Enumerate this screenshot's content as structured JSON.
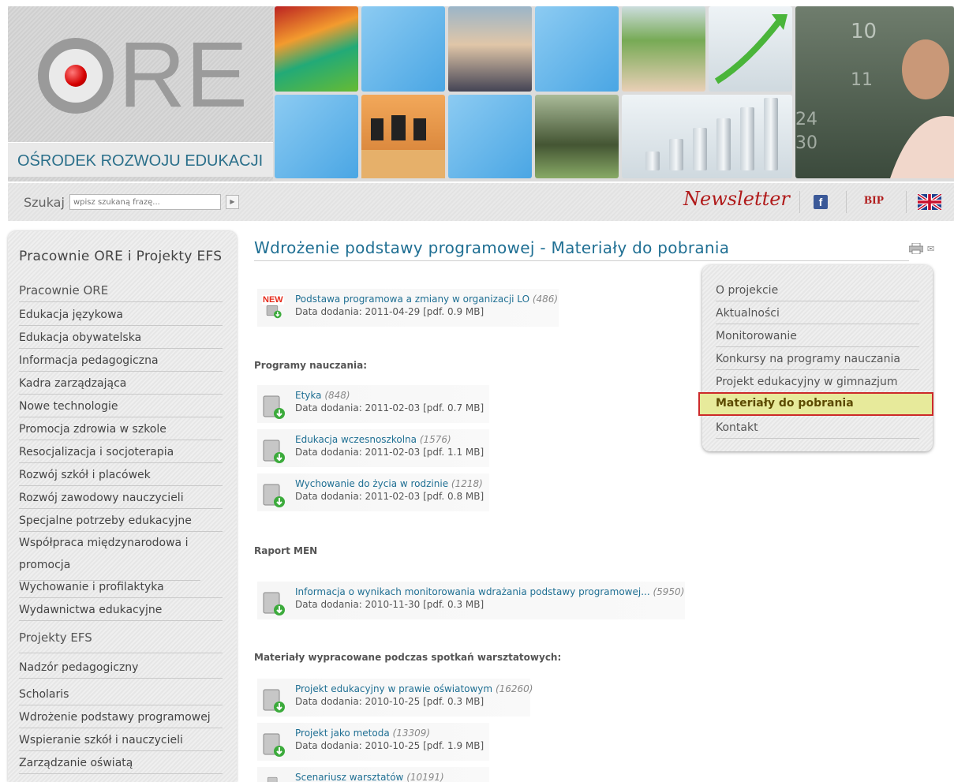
{
  "header": {
    "logo_text": "ORE",
    "logo_re": "RE",
    "org_name": "OŚRODEK ROZWOJU EDUKACJI"
  },
  "search": {
    "label": "Szukaj",
    "placeholder": "wpisz szukaną frazę...",
    "button_glyph": "▶"
  },
  "topbar": {
    "newsletter": "Newsletter",
    "facebook_glyph": "f",
    "bip": "BIP",
    "english_flag": "uk-flag-icon"
  },
  "sidebar": {
    "title": "Pracownie ORE i Projekty EFS",
    "section1": "Pracownie ORE",
    "items1": [
      "Edukacja językowa",
      "Edukacja obywatelska",
      "Informacja pedagogiczna",
      "Kadra zarządzająca",
      "Nowe technologie",
      "Promocja zdrowia w szkole",
      "Resocjalizacja i socjoterapia",
      "Rozwój szkół i placówek",
      "Rozwój zawodowy nauczycieli",
      "Specjalne potrzeby edukacyjne",
      "Współpraca międzynarodowa i promocja",
      "Wychowanie i profilaktyka",
      "Wydawnictwa edukacyjne"
    ],
    "section2": "Projekty EFS",
    "items2": [
      "Nadzór pedagogiczny",
      "Scholaris",
      "Wdrożenie podstawy programowej",
      "Wspieranie szkół i nauczycieli",
      "Zarządzanie oświatą"
    ]
  },
  "main": {
    "title": "Wdrożenie podstawy programowej - Materiały do pobrania",
    "new_badge": "NEW",
    "docs_top": [
      {
        "title": "Podstawa programowa a zmiany w organizacji LO",
        "count": "(486)",
        "meta": "Data dodania: 2011-04-29 [pdf. 0.9 MB]"
      }
    ],
    "section_programs": "Programy nauczania:",
    "docs_programs": [
      {
        "title": "Etyka",
        "count": "(848)",
        "meta": "Data dodania: 2011-02-03 [pdf. 0.7 MB]"
      },
      {
        "title": "Edukacja wczesnoszkolna",
        "count": "(1576)",
        "meta": "Data dodania: 2011-02-03 [pdf. 1.1 MB]"
      },
      {
        "title": "Wychowanie do życia w rodzinie",
        "count": "(1218)",
        "meta": "Data dodania: 2011-02-03 [pdf. 0.8 MB]"
      }
    ],
    "section_raport": "Raport MEN",
    "docs_raport": [
      {
        "title": "Informacja o wynikach monitorowania wdrażania podstawy programowej...",
        "count": "(5950)",
        "meta": "Data dodania: 2010-11-30 [pdf. 0.3 MB]"
      }
    ],
    "section_workshops": "Materiały wypracowane podczas spotkań warsztatowych:",
    "docs_workshops": [
      {
        "title": "Projekt edukacyjny w prawie oświatowym",
        "count": "(16260)",
        "meta": "Data dodania: 2010-10-25 [pdf. 0.3 MB]"
      },
      {
        "title": "Projekt jako metoda",
        "count": "(13309)",
        "meta": "Data dodania: 2010-10-25 [pdf. 1.9 MB]"
      },
      {
        "title": "Scenariusz warsztatów",
        "count": "(10191)",
        "meta": ""
      }
    ]
  },
  "submenu": {
    "items": [
      "O projekcie",
      "Aktualności",
      "Monitorowanie",
      "Konkursy na programy nauczania",
      "Projekt edukacyjny w gimnazjum",
      "Materiały do pobrania",
      "Kontakt"
    ],
    "active_index": 5
  },
  "colors": {
    "link": "#1f6f93",
    "active_bg": "#e7ea9b",
    "active_border": "#cc2a2a",
    "newsletter": "#b01a1a"
  }
}
